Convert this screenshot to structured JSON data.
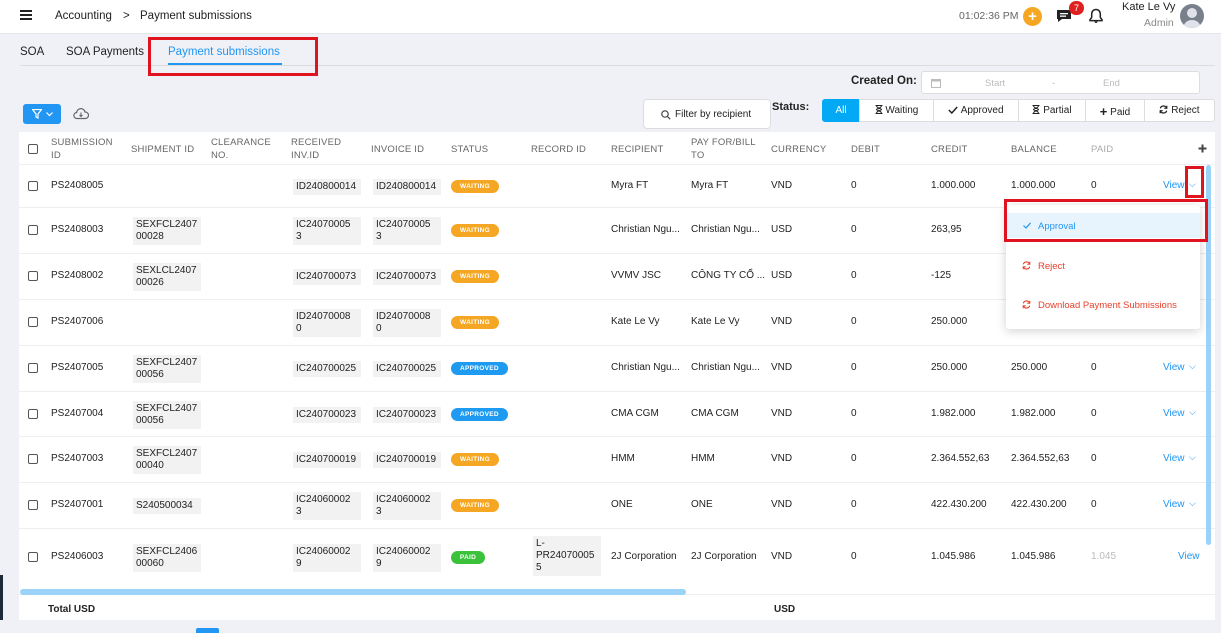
{
  "header": {
    "breadcrumb_root": "Accounting",
    "breadcrumb_sep": ">",
    "breadcrumb_current": "Payment submissions",
    "clock": "01:02:36 PM",
    "notification_count": "7",
    "user_name": "Kate Le Vy",
    "user_role": "Admin"
  },
  "tabs": [
    "SOA",
    "SOA Payments",
    "Payment submissions"
  ],
  "filters": {
    "created_on_label": "Created On:",
    "start_placeholder": "Start",
    "dash": "-",
    "end_placeholder": "End",
    "filter_recipient": "Filter by recipient",
    "status_label": "Status:",
    "status_options": [
      "All",
      "Waiting",
      "Approved",
      "Partial",
      "Paid",
      "Reject"
    ]
  },
  "columns": [
    "SUBMISSION ID",
    "SHIPMENT ID",
    "CLEARANCE NO.",
    "RECEIVED INV.ID",
    "INVOICE ID",
    "STATUS",
    "RECORD ID",
    "RECIPIENT",
    "PAY FOR/BILL TO",
    "CURRENCY",
    "DEBIT",
    "CREDIT",
    "BALANCE",
    "PAID"
  ],
  "rows": [
    {
      "id": "PS2408005",
      "shipment": "",
      "clearance": "",
      "received": "ID240800014",
      "invoice": "ID240800014",
      "status": "WAITING",
      "record": "",
      "recipient": "Myra FT",
      "payfor": "Myra FT",
      "currency": "VND",
      "debit": "0",
      "credit": "1.000.000",
      "balance": "1.000.000",
      "paid": "0",
      "view": "View"
    },
    {
      "id": "PS2408003",
      "shipment": "SEXFCL2407 00028",
      "clearance": "",
      "received": "IC24070005 3",
      "invoice": "IC24070005 3",
      "status": "WAITING",
      "record": "",
      "recipient": "Christian Ngu...",
      "payfor": "Christian Ngu...",
      "currency": "USD",
      "debit": "0",
      "credit": "263,95",
      "balance": "",
      "paid": "",
      "view": ""
    },
    {
      "id": "PS2408002",
      "shipment": "SEXLCL2407 00026",
      "clearance": "",
      "received": "IC240700073",
      "invoice": "IC240700073",
      "status": "WAITING",
      "record": "",
      "recipient": "VVMV JSC",
      "payfor": "CÔNG TY CỔ ...",
      "currency": "USD",
      "debit": "0",
      "credit": "-125",
      "balance": "",
      "paid": "",
      "view": ""
    },
    {
      "id": "PS2407006",
      "shipment": "",
      "clearance": "",
      "received": "ID24070008 0",
      "invoice": "ID24070008 0",
      "status": "WAITING",
      "record": "",
      "recipient": "Kate Le Vy",
      "payfor": "Kate Le Vy",
      "currency": "VND",
      "debit": "0",
      "credit": "250.000",
      "balance": "",
      "paid": "",
      "view": ""
    },
    {
      "id": "PS2407005",
      "shipment": "SEXFCL2407 00056",
      "clearance": "",
      "received": "IC240700025",
      "invoice": "IC240700025",
      "status": "APPROVED",
      "record": "",
      "recipient": "Christian Ngu...",
      "payfor": "Christian Ngu...",
      "currency": "VND",
      "debit": "0",
      "credit": "250.000",
      "balance": "250.000",
      "paid": "0",
      "view": "View"
    },
    {
      "id": "PS2407004",
      "shipment": "SEXFCL2407 00056",
      "clearance": "",
      "received": "IC240700023",
      "invoice": "IC240700023",
      "status": "APPROVED",
      "record": "",
      "recipient": "CMA CGM",
      "payfor": "CMA CGM",
      "currency": "VND",
      "debit": "0",
      "credit": "1.982.000",
      "balance": "1.982.000",
      "paid": "0",
      "view": "View"
    },
    {
      "id": "PS2407003",
      "shipment": "SEXFCL2407 00040",
      "clearance": "",
      "received": "IC240700019",
      "invoice": "IC240700019",
      "status": "WAITING",
      "record": "",
      "recipient": "HMM",
      "payfor": "HMM",
      "currency": "VND",
      "debit": "0",
      "credit": "2.364.552,63",
      "balance": "2.364.552,63",
      "paid": "0",
      "view": "View"
    },
    {
      "id": "PS2407001",
      "shipment": "S240500034",
      "clearance": "",
      "received": "IC24060002 3",
      "invoice": "IC24060002 3",
      "status": "WAITING",
      "record": "",
      "recipient": "ONE",
      "payfor": "ONE",
      "currency": "VND",
      "debit": "0",
      "credit": "422.430.200",
      "balance": "422.430.200",
      "paid": "0",
      "view": "View"
    },
    {
      "id": "PS2406003",
      "shipment": "SEXFCL2406 00060",
      "clearance": "",
      "received": "IC24060002 9",
      "invoice": "IC24060002 9",
      "status": "PAID",
      "record": "L- PR24070005 5",
      "recipient": "2J Corporation",
      "payfor": "2J Corporation",
      "currency": "VND",
      "debit": "0",
      "credit": "1.045.986",
      "balance": "1.045.986",
      "paid": "1.045",
      "view": "View"
    }
  ],
  "menu": {
    "approval": "Approval",
    "reject": "Reject",
    "download": "Download Payment Submissions"
  },
  "footer": {
    "total_label": "Total USD",
    "total_currency": "USD"
  },
  "colors": {
    "waiting": "#f5a623",
    "approved": "#1e9bf0",
    "paid": "#3cc13b",
    "accent": "#2196f3",
    "highlight": "#e0141e"
  }
}
